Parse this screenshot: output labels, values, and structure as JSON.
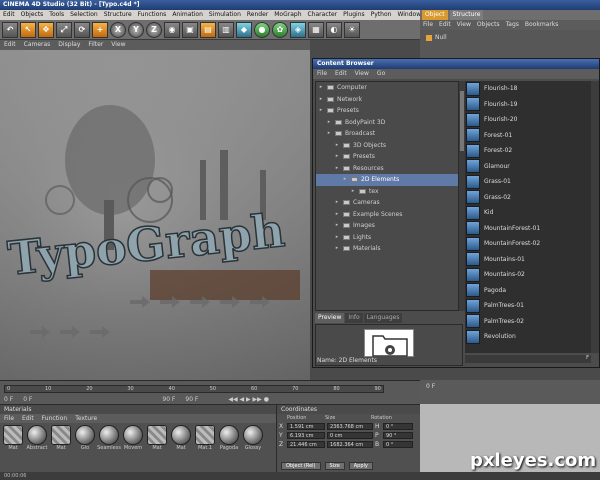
{
  "window_title": "CINEMA 4D Studio (32 Bit) - [Typo.c4d *]",
  "menubar": [
    "Edit",
    "Objects",
    "Tools",
    "Selection",
    "Structure",
    "Functions",
    "Animation",
    "Simulation",
    "Render",
    "MoGraph",
    "Character",
    "Plugins",
    "Python",
    "Window",
    "Help"
  ],
  "toolbar_icons": [
    "undo-icon",
    "live-select-icon",
    "move-icon",
    "scale-icon",
    "rotate-icon",
    "x-axis-icon",
    "y-axis-icon",
    "z-axis-icon",
    "coord-icon",
    "render-view-icon",
    "render-icon",
    "render-settings-icon",
    "cube-icon",
    "nurbs-icon",
    "array-icon",
    "deformer-icon",
    "scene-icon",
    "camera-icon",
    "light-icon"
  ],
  "toolbar_labels": {
    "x": "X",
    "y": "Y",
    "z": "Z"
  },
  "viewport_menu": [
    "Edit",
    "Cameras",
    "Display",
    "Filter",
    "View"
  ],
  "viewport_text": "TypoGraph",
  "right_tabs": [
    "Object",
    "Structure"
  ],
  "right_menu": [
    "File",
    "Edit",
    "View",
    "Objects",
    "Tags",
    "Bookmarks"
  ],
  "right_object": "Null",
  "content_browser": {
    "title": "Content Browser",
    "menu": [
      "File",
      "Edit",
      "View",
      "Go"
    ],
    "tree": [
      {
        "label": "Computer",
        "level": 0,
        "selected": false
      },
      {
        "label": "Network",
        "level": 0,
        "selected": false
      },
      {
        "label": "Presets",
        "level": 0,
        "selected": false
      },
      {
        "label": "BodyPaint 3D",
        "level": 1,
        "selected": false
      },
      {
        "label": "Broadcast",
        "level": 1,
        "selected": false
      },
      {
        "label": "3D Objects",
        "level": 2,
        "selected": false
      },
      {
        "label": "Presets",
        "level": 2,
        "selected": false
      },
      {
        "label": "Resources",
        "level": 2,
        "selected": false
      },
      {
        "label": "2D Elements",
        "level": 3,
        "selected": true
      },
      {
        "label": "tex",
        "level": 4,
        "selected": false
      },
      {
        "label": "Cameras",
        "level": 2,
        "selected": false
      },
      {
        "label": "Example Scenes",
        "level": 2,
        "selected": false
      },
      {
        "label": "Images",
        "level": 2,
        "selected": false
      },
      {
        "label": "Lights",
        "level": 2,
        "selected": false
      },
      {
        "label": "Materials",
        "level": 2,
        "selected": false
      }
    ],
    "preview_tabs": [
      "Preview",
      "Info",
      "Languages"
    ],
    "name_label": "Name: 2D Elements",
    "items": [
      "Flourish-18",
      "Flourish-19",
      "Flourish-20",
      "Forest-01",
      "Forest-02",
      "Glamour",
      "Grass-01",
      "Grass-02",
      "Kid",
      "MountainForest-01",
      "MountainForest-02",
      "Mountains-01",
      "Mountains-02",
      "Pagoda",
      "PalmTrees-01",
      "PalmTrees-02",
      "Revolution"
    ],
    "zoom_value": "F"
  },
  "timeline": {
    "ticks": [
      "0",
      "10",
      "20",
      "30",
      "40",
      "50",
      "60",
      "70",
      "80",
      "90"
    ],
    "current_frame": "0 F",
    "start": "0 F",
    "end": "90 F",
    "max": "90 F",
    "right_value": "0 F"
  },
  "materials": {
    "header": "Materials",
    "menu": [
      "File",
      "Edit",
      "Function",
      "Texture"
    ],
    "items": [
      "Mat",
      "Abstract",
      "Mat",
      "Glo",
      "Seamless",
      "Movem",
      "Mat",
      "Mat",
      "Mat.1",
      "Pagoda",
      "Glossy"
    ]
  },
  "coordinates": {
    "header": "Coordinates",
    "cols": [
      "Position",
      "Size",
      "Rotation"
    ],
    "rows": [
      {
        "axis": "X",
        "pos": "1.591 cm",
        "size": "2363.768 cm",
        "rot_axis": "H",
        "rot": "0 °"
      },
      {
        "axis": "Y",
        "pos": "6.193 cm",
        "size": "0 cm",
        "rot_axis": "P",
        "rot": "90 °"
      },
      {
        "axis": "Z",
        "pos": "21.446 cm",
        "size": "1682.364 cm",
        "rot_axis": "B",
        "rot": "0 °"
      }
    ],
    "mode": "Object (Rel)",
    "size_mode": "Size",
    "apply": "Apply"
  },
  "status": "00:00:06",
  "watermark": "pxleyes.com"
}
